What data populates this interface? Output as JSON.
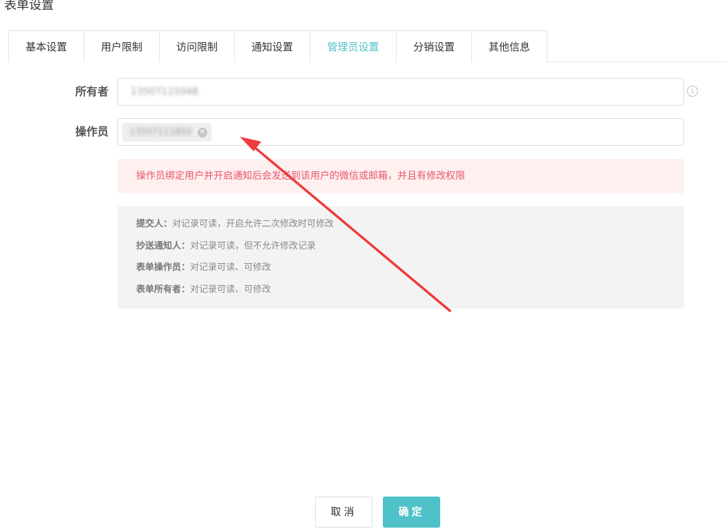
{
  "page": {
    "title": "表单设置"
  },
  "tabs": [
    {
      "label": "基本设置",
      "active": false
    },
    {
      "label": "用户限制",
      "active": false
    },
    {
      "label": "访问限制",
      "active": false
    },
    {
      "label": "通知设置",
      "active": false
    },
    {
      "label": "管理员设置",
      "active": true
    },
    {
      "label": "分销设置",
      "active": false
    },
    {
      "label": "其他信息",
      "active": false
    }
  ],
  "owner": {
    "label": "所有者",
    "value": "13507115048",
    "info_icon": "info-circle-icon"
  },
  "operator": {
    "label": "操作员",
    "tag_value": "13507111850",
    "remove_icon": "close-circle-icon"
  },
  "alert": {
    "text": "操作员绑定用户并开启通知后会发送到该用户的微信或邮箱，并且有修改权限"
  },
  "roles": [
    {
      "name": "提交人：",
      "desc": "对记录可读，开启允许二次修改时可修改"
    },
    {
      "name": "抄送通知人：",
      "desc": "对记录可读，但不允许修改记录"
    },
    {
      "name": "表单操作员：",
      "desc": "对记录可读、可修改"
    },
    {
      "name": "表单所有者：",
      "desc": "对记录可读、可修改"
    }
  ],
  "buttons": {
    "cancel": "取消",
    "confirm": "确定"
  },
  "colors": {
    "accent": "#4fc1c8",
    "alert_text": "#e8566b",
    "alert_bg": "#fff0f0",
    "annotation_arrow": "#ee3b3b"
  }
}
